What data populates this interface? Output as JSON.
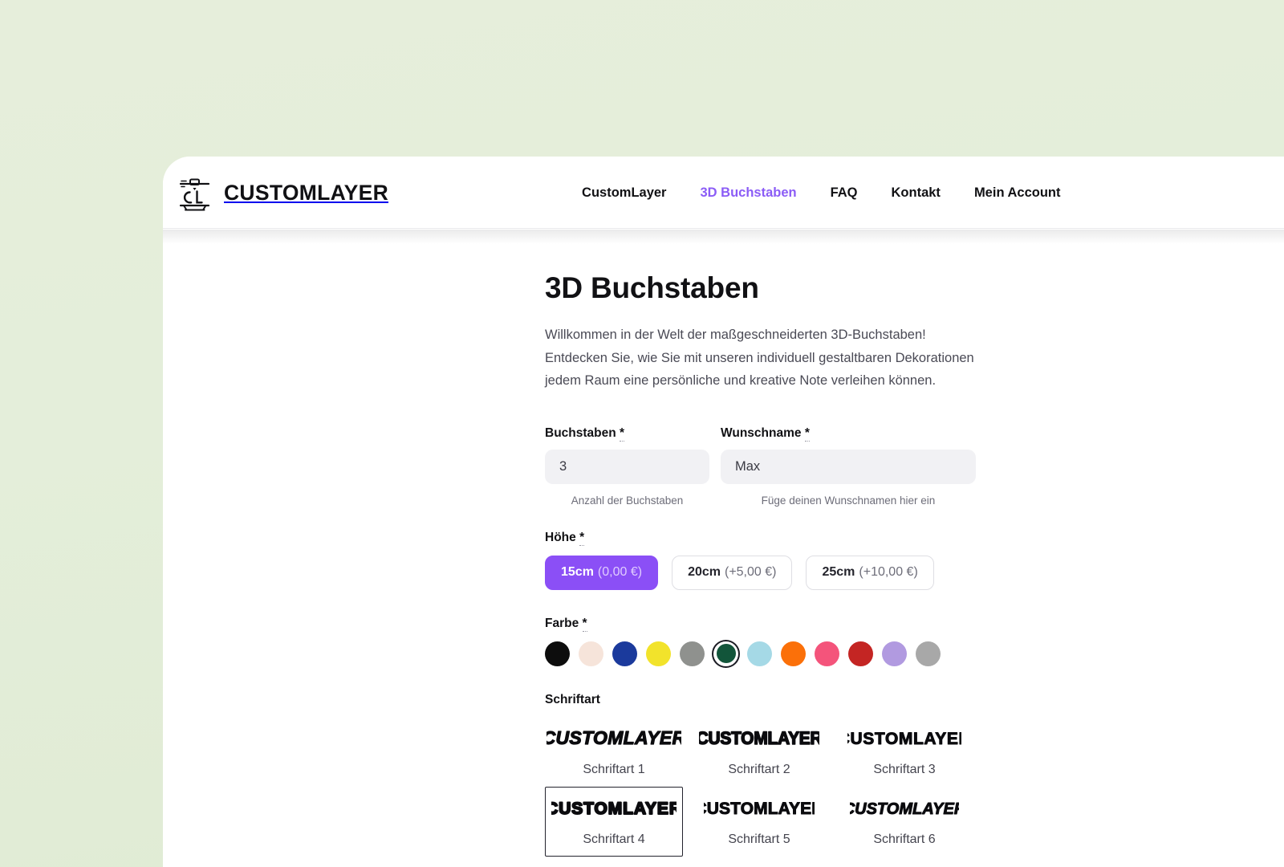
{
  "theme": {
    "page_background": "#e4eeda",
    "accent_purple": "#8b5cf6",
    "selected_chip": "#8b4ff6",
    "card_background": "#ffffff"
  },
  "header": {
    "brand_name": "CUSTOMLAYER",
    "brand_logo_icon": "cl-3d-printer-logo-icon",
    "nav": [
      {
        "label": "CustomLayer",
        "active": false
      },
      {
        "label": "3D Buchstaben",
        "active": true
      },
      {
        "label": "FAQ",
        "active": false
      },
      {
        "label": "Kontakt",
        "active": false
      },
      {
        "label": "Mein Account",
        "active": false
      }
    ]
  },
  "main": {
    "title": "3D Buchstaben",
    "intro": "Willkommen in der Welt der maßgeschneiderten 3D-Buchstaben! Entdecken Sie, wie Sie mit unseren individuell gestaltbaren Dekorationen jedem Raum eine persönliche und kreative Note verleihen können.",
    "fields": {
      "letter_count": {
        "label": "Buchstaben",
        "required_marker": "*",
        "value": "3",
        "placeholder": "3",
        "helper": "Anzahl der Buchstaben",
        "spinner_icon": "stepper-up-down-icon"
      },
      "wish_name": {
        "label": "Wunschname",
        "required_marker": "*",
        "value": "Max",
        "placeholder": "Max",
        "helper": "Füge deinen Wunschnamen hier ein"
      }
    },
    "height": {
      "label": "Höhe",
      "required_marker": "*",
      "options": [
        {
          "size": "15cm",
          "price": "(0,00 €)",
          "selected": true
        },
        {
          "size": "20cm",
          "price": "(+5,00 €)",
          "selected": false
        },
        {
          "size": "25cm",
          "price": "(+10,00 €)",
          "selected": false
        }
      ]
    },
    "color": {
      "label": "Farbe",
      "required_marker": "*",
      "options": [
        {
          "name": "schwarz",
          "hex": "#0d0d0d",
          "selected": false
        },
        {
          "name": "creme",
          "hex": "#f6e4da",
          "selected": false
        },
        {
          "name": "dunkelblau",
          "hex": "#1b3a9c",
          "selected": false
        },
        {
          "name": "gelb",
          "hex": "#f2e32b",
          "selected": false
        },
        {
          "name": "grau",
          "hex": "#8f918e",
          "selected": false
        },
        {
          "name": "dunkelgruen",
          "hex": "#12553a",
          "selected": true
        },
        {
          "name": "hellblau",
          "hex": "#a5d9e6",
          "selected": false
        },
        {
          "name": "orange",
          "hex": "#fb7009",
          "selected": false
        },
        {
          "name": "pink",
          "hex": "#f4547b",
          "selected": false
        },
        {
          "name": "rot",
          "hex": "#c42523",
          "selected": false
        },
        {
          "name": "lila",
          "hex": "#b19ae0",
          "selected": false
        },
        {
          "name": "silber",
          "hex": "#a8a8a8",
          "selected": false
        }
      ]
    },
    "font": {
      "label": "Schriftart",
      "sample_text": "CUSTOMLAYER",
      "options": [
        {
          "name": "Schriftart 1",
          "selected": false,
          "style": "italic-bold-rounded"
        },
        {
          "name": "Schriftart 2",
          "selected": false,
          "style": "condensed-heavy"
        },
        {
          "name": "Schriftart 3",
          "selected": false,
          "style": "squared-block"
        },
        {
          "name": "Schriftart 4",
          "selected": true,
          "style": "wide-soft-bold"
        },
        {
          "name": "Schriftart 5",
          "selected": false,
          "style": "brush-upright"
        },
        {
          "name": "Schriftart 6",
          "selected": false,
          "style": "brush-italic"
        }
      ]
    }
  }
}
